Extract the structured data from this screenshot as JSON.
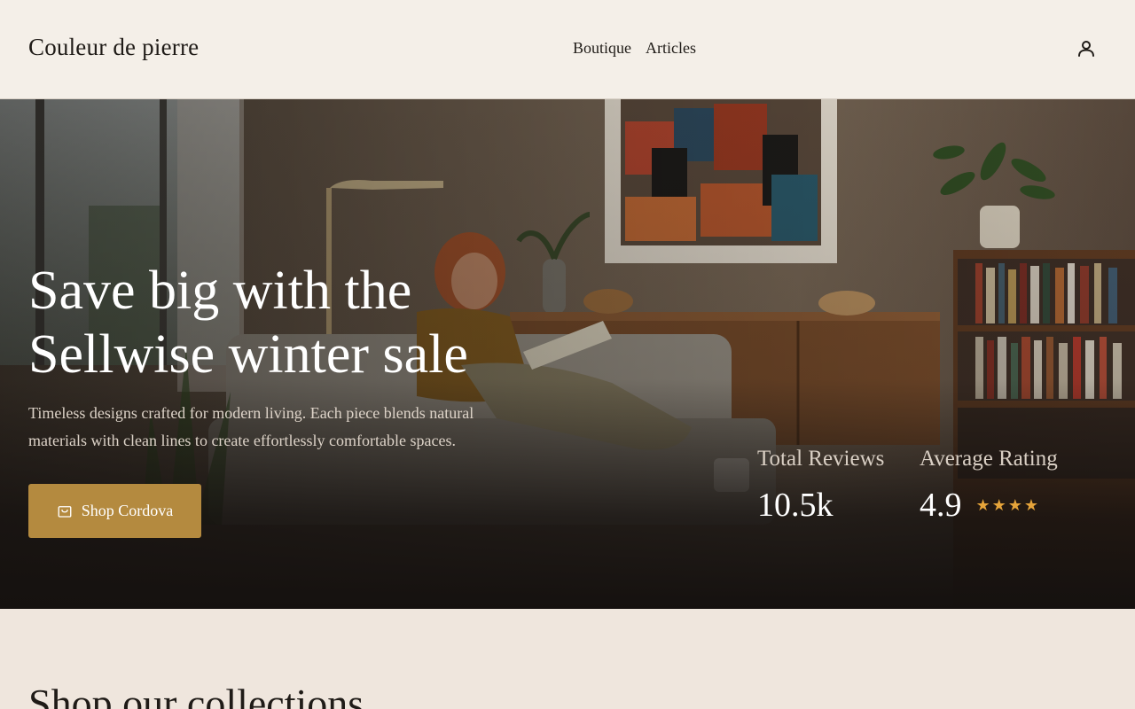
{
  "header": {
    "brand": "Couleur de pierre",
    "nav": [
      {
        "label": "Boutique"
      },
      {
        "label": "Articles"
      }
    ],
    "account_icon": "user-icon"
  },
  "hero": {
    "title_line1": "Save big with the",
    "title_line2": "Sellwise winter sale",
    "subtitle": "Timeless designs crafted for modern living. Each piece blends natural materials with clean lines to create effortlessly comfortable spaces.",
    "cta": {
      "label": "Shop Cordova",
      "icon": "shopping-bag-icon"
    },
    "stats": [
      {
        "label": "Total Reviews",
        "value": "10.5k"
      },
      {
        "label": "Average Rating",
        "value": "4.9",
        "stars": 4
      }
    ],
    "background": "photo-living-room-woman-reading-on-sofa"
  },
  "collections": {
    "heading": "Shop our collections"
  },
  "colors": {
    "header_bg": "#f4efe8",
    "page_bg": "#efe6dd",
    "accent": "#b48a3f",
    "star": "#e6a43a",
    "text_dark": "#1f1b17"
  }
}
